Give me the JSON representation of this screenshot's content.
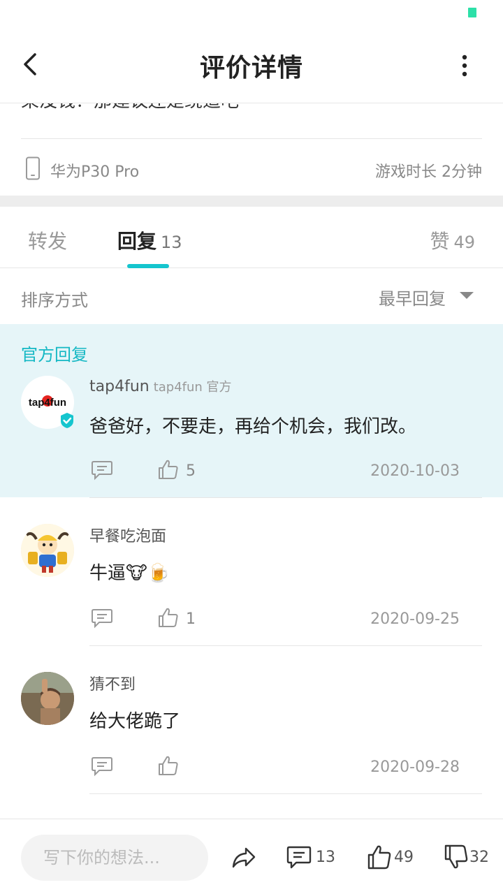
{
  "header": {
    "title": "评价详情"
  },
  "review": {
    "cut_text": "果没钱？那建议还是绕道吧",
    "device": "华为P30 Pro",
    "play_time": "游戏时长 2分钟"
  },
  "tabs": {
    "forward": {
      "label": "转发"
    },
    "reply": {
      "label": "回复",
      "count": "13"
    },
    "like": {
      "label": "赞",
      "count": "49"
    }
  },
  "sort": {
    "label": "排序方式",
    "selected": "最早回复"
  },
  "official": {
    "section_label": "官方回复",
    "name": "tap4fun",
    "sub": "tap4fun 官方",
    "avatar_text": "tap4fun",
    "content": "爸爸好，不要走，再给个机会，我们改。",
    "likes": "5",
    "date": "2020-10-03"
  },
  "replies": [
    {
      "name": "早餐吃泡面",
      "content": "牛逼🐮🍺",
      "likes": "1",
      "date": "2020-09-25"
    },
    {
      "name": "猜不到",
      "content": "给大佬跪了",
      "likes": "",
      "date": "2020-09-28"
    }
  ],
  "bottom_bar": {
    "input_placeholder": "写下你的想法...",
    "comment_count": "13",
    "like_count": "49",
    "dislike_count": "32"
  },
  "colors": {
    "accent": "#15c5ce",
    "official_bg": "#e6f5f8",
    "status": "#2de0a8"
  }
}
